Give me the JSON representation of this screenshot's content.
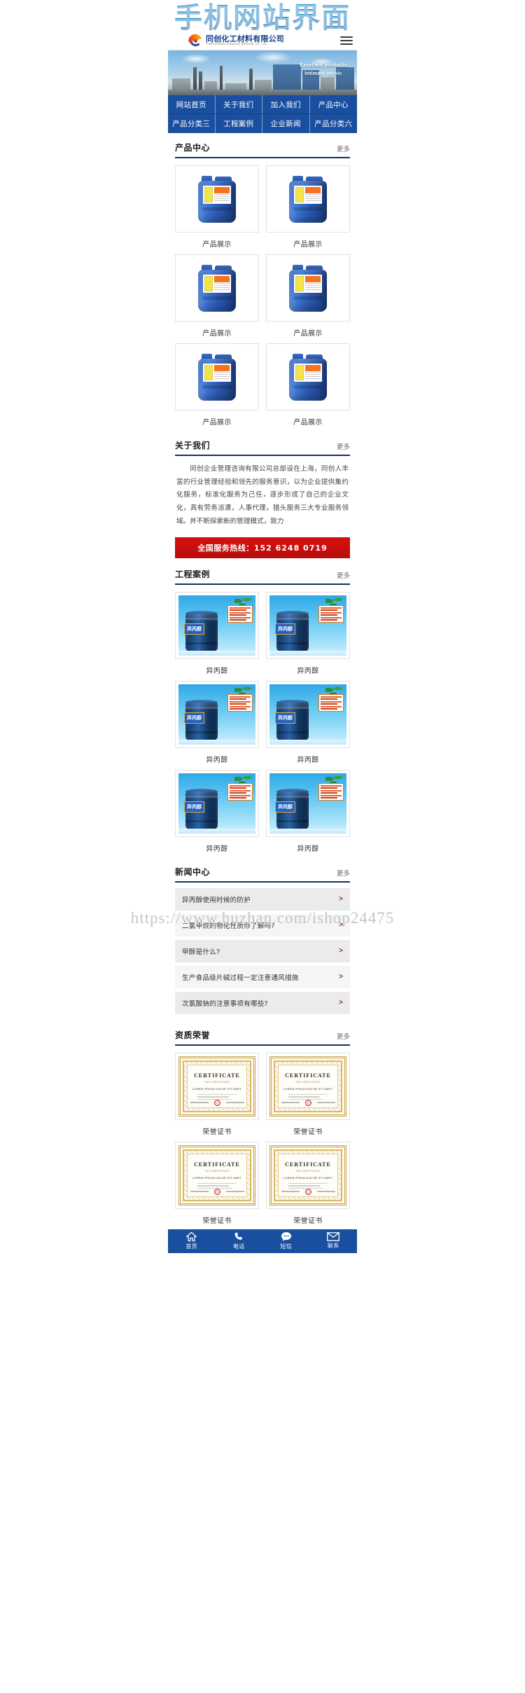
{
  "page": {
    "big_title": "手机网站界面",
    "watermark": "https://www.huzhan.com/ishop24475"
  },
  "header": {
    "logo_cn": "同创化工材料有限公司",
    "logo_en": "TONGCHUANG CHEMICAL MATERIAL CO., LTD",
    "menu_icon": "hamburger-menu-icon"
  },
  "banner": {
    "caption_line1": "Excellent products",
    "caption_line2": "Intimate  servic"
  },
  "nav": {
    "rows": [
      [
        "网站首页",
        "关于我们",
        "加入我们",
        "产品中心"
      ],
      [
        "产品分类三",
        "工程案例",
        "企业新闻",
        "产品分类六"
      ]
    ]
  },
  "sections": {
    "products": {
      "title": "产品中心",
      "more": "更多",
      "items": [
        {
          "label": "产品展示"
        },
        {
          "label": "产品展示"
        },
        {
          "label": "产品展示"
        },
        {
          "label": "产品展示"
        },
        {
          "label": "产品展示"
        },
        {
          "label": "产品展示"
        }
      ]
    },
    "about": {
      "title": "关于我们",
      "more": "更多",
      "body": "同创企业管理咨询有限公司总部设在上海，同创人丰富的行业管理经验和领先的服务意识，以为企业提供集约化服务，标准化服务为己任，逐步形成了自己的企业文化，具有劳务派遣，人事代理，猎头服务三大专业服务领域。并不断探索新的管理模式，致力",
      "hotline_label": "全国服务热线：",
      "hotline_number": "152 6248 0719"
    },
    "cases": {
      "title": "工程案例",
      "more": "更多",
      "items": [
        {
          "label": "异丙醇",
          "tag": "异丙醇"
        },
        {
          "label": "异丙醇",
          "tag": "异丙醇"
        },
        {
          "label": "异丙醇",
          "tag": "异丙醇"
        },
        {
          "label": "异丙醇",
          "tag": "异丙醇"
        },
        {
          "label": "异丙醇",
          "tag": "异丙醇"
        },
        {
          "label": "异丙醇",
          "tag": "异丙醇"
        }
      ]
    },
    "news": {
      "title": "新闻中心",
      "more": "更多",
      "arrow": ">",
      "items": [
        {
          "text": "异丙醇使用时候的防护"
        },
        {
          "text": "二氯甲烷的物化性质你了解吗?"
        },
        {
          "text": "甲醇是什么?"
        },
        {
          "text": "生产食品级片碱过程一定注意通风措施"
        },
        {
          "text": "次氯酸钠的注意事项有哪些?"
        }
      ]
    },
    "honors": {
      "title": "资质荣誉",
      "more": "更多",
      "cert_title": "CERTIFICATE",
      "cert_sub": "THE CERTIFICATE",
      "cert_head": "LOREM IPSUM DOLOR SIT AMET",
      "items": [
        {
          "label": "荣誉证书"
        },
        {
          "label": "荣誉证书"
        },
        {
          "label": "荣誉证书"
        },
        {
          "label": "荣誉证书"
        }
      ]
    }
  },
  "bottombar": {
    "items": [
      {
        "label": "首页",
        "icon": "home-icon"
      },
      {
        "label": "电话",
        "icon": "phone-icon"
      },
      {
        "label": "短信",
        "icon": "message-icon"
      },
      {
        "label": "联系",
        "icon": "mail-icon"
      }
    ]
  },
  "colors": {
    "brand_blue": "#1a4fa0",
    "title_blue": "#1a7fc1",
    "hotline_red": "#d9110f",
    "section_underline": "#16325c"
  }
}
